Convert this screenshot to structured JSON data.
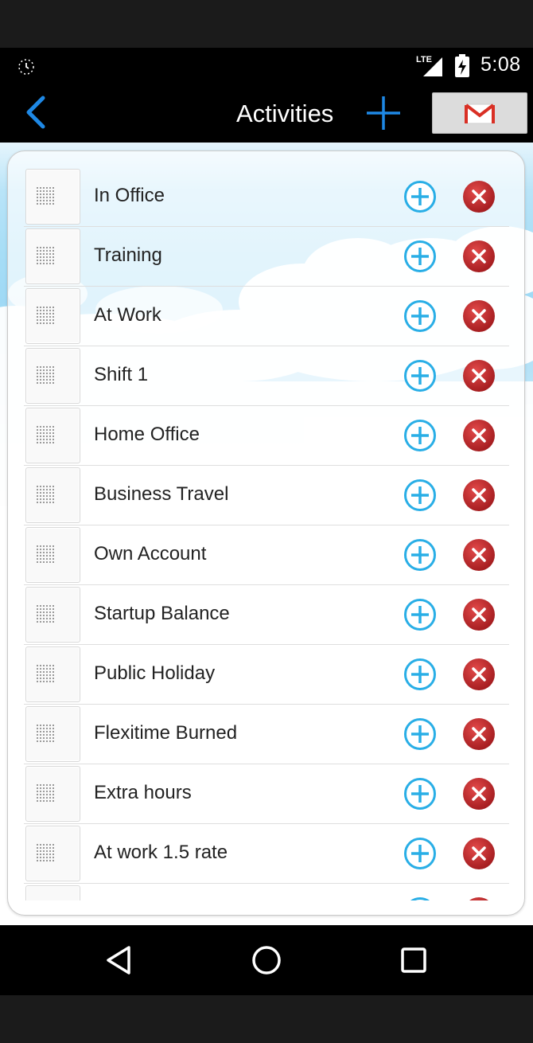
{
  "status_bar": {
    "network": "LTE",
    "time": "5:08",
    "icons": [
      "alarm-icon",
      "lte-signal-icon",
      "battery-charging-icon"
    ]
  },
  "app_bar": {
    "title": "Activities",
    "back_icon": "chevron-left-icon",
    "add_icon": "plus-icon",
    "gmail_icon": "gmail-icon",
    "colors": {
      "accent": "#1e88e5",
      "gmail_red": "#d93025",
      "background": "#000000"
    }
  },
  "activities": [
    {
      "label": "In Office"
    },
    {
      "label": "Training"
    },
    {
      "label": "At Work"
    },
    {
      "label": "Shift 1"
    },
    {
      "label": "Home Office"
    },
    {
      "label": "Business Travel"
    },
    {
      "label": "Own Account"
    },
    {
      "label": "Startup Balance"
    },
    {
      "label": "Public Holiday"
    },
    {
      "label": "Flexitime Burned"
    },
    {
      "label": "Extra hours"
    },
    {
      "label": "At work 1.5 rate"
    },
    {
      "label": ""
    }
  ],
  "row_icons": {
    "handle": "drag-handle-icon",
    "add": "add-circle-icon",
    "delete": "delete-circle-icon"
  },
  "row_colors": {
    "add": "#29aee6",
    "delete": "#c8282b"
  },
  "nav_bar": {
    "icons": [
      "back-triangle-icon",
      "home-circle-icon",
      "recents-square-icon"
    ]
  }
}
